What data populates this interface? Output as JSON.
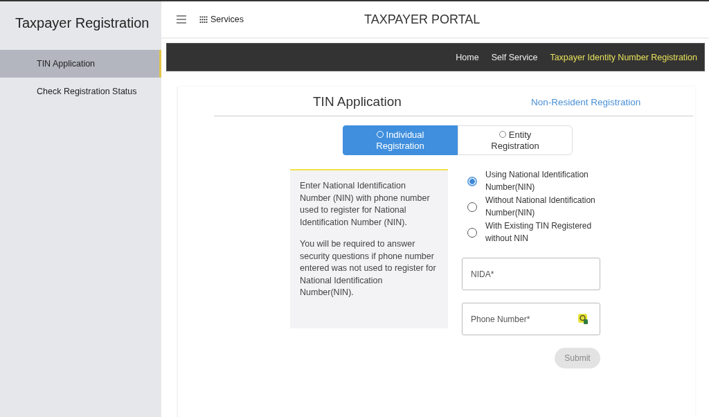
{
  "sidebar": {
    "title": "Taxpayer Registration",
    "items": [
      {
        "label": "TIN Application",
        "selected": true
      },
      {
        "label": "Check Registration Status",
        "selected": false
      }
    ]
  },
  "header": {
    "services": "Services",
    "title": "TAXPAYER PORTAL"
  },
  "breadcrumb": [
    {
      "label": "Home",
      "selected": false
    },
    {
      "label": "Self Service",
      "selected": false
    },
    {
      "label": "Taxpayer Identity Number Registration",
      "selected": true
    }
  ],
  "form": {
    "title": "TIN Application",
    "link": "Non-Resident Registration",
    "tabs": [
      {
        "label": "Individual Registration",
        "selected": true
      },
      {
        "label": "Entity Registration",
        "selected": false
      }
    ],
    "info": [
      "Enter National Identification Number (NIN) with phone number used to register for National Identification Number (NIN).",
      "You will be required to answer security questions if phone number entered was not used to register for National Identification Number(NIN)."
    ],
    "options": [
      {
        "label": "Using National Identification Number(NIN)",
        "selected": true
      },
      {
        "label": "Without National Identification Number(NIN)",
        "selected": false
      },
      {
        "label": "With Existing TIN Registered without NIN",
        "selected": false
      }
    ],
    "fields": [
      {
        "placeholder": "NIDA*",
        "kind": "text"
      },
      {
        "placeholder": "Phone Number*",
        "kind": "phone"
      }
    ],
    "submit": {
      "label": "Submit",
      "disabled": true
    }
  }
}
